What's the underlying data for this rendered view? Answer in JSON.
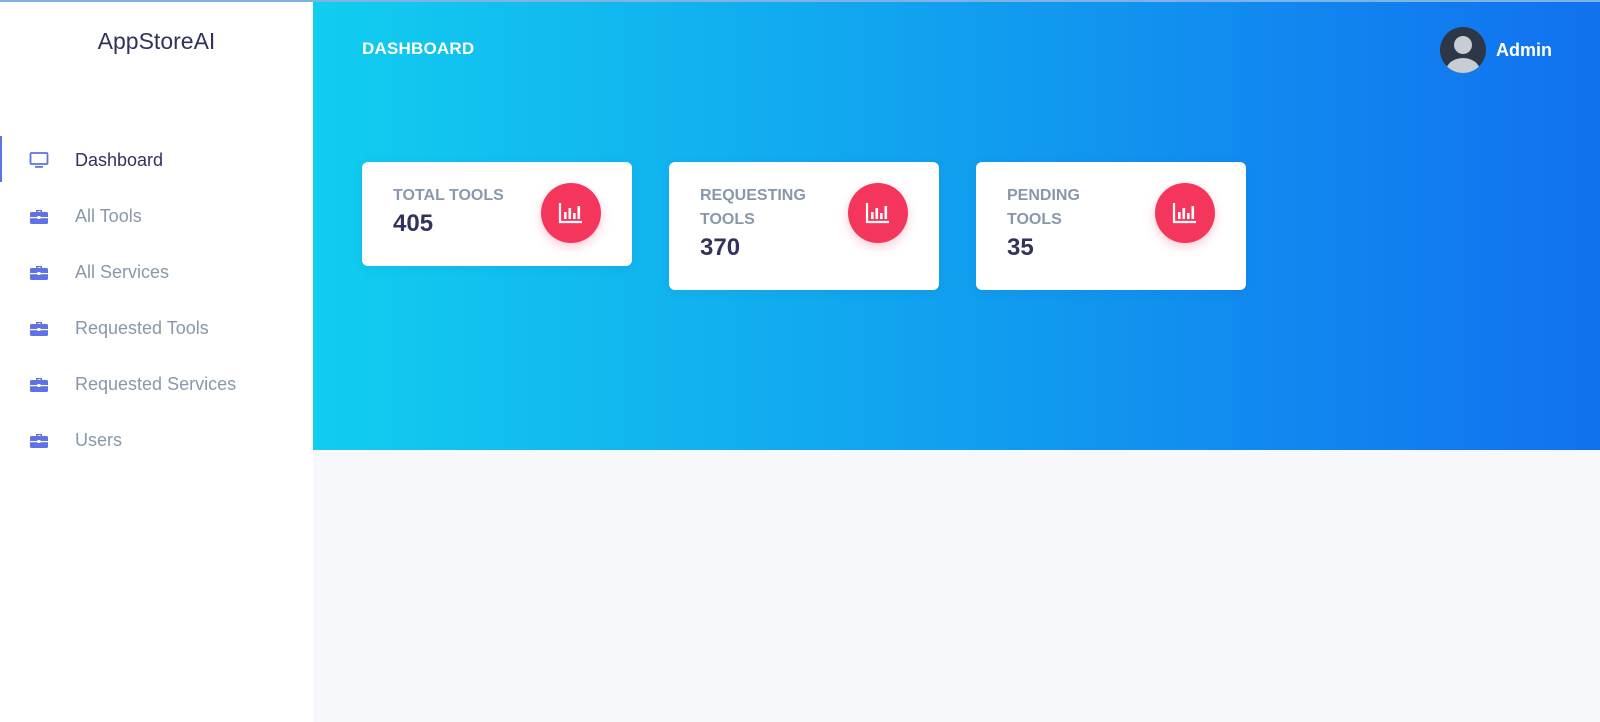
{
  "brand": "AppStoreAI",
  "page_title": "DASHBOARD",
  "user": {
    "name": "Admin",
    "avatar_icon": "user-avatar-icon"
  },
  "nav": [
    {
      "label": "Dashboard",
      "icon": "monitor-icon",
      "active": true
    },
    {
      "label": "All Tools",
      "icon": "briefcase-icon",
      "active": false
    },
    {
      "label": "All Services",
      "icon": "briefcase-icon",
      "active": false
    },
    {
      "label": "Requested Tools",
      "icon": "briefcase-icon",
      "active": false
    },
    {
      "label": "Requested Services",
      "icon": "briefcase-icon",
      "active": false
    },
    {
      "label": "Users",
      "icon": "briefcase-icon",
      "active": false
    }
  ],
  "stats": [
    {
      "title": "TOTAL TOOLS",
      "value": "405",
      "icon": "chart-bar-icon"
    },
    {
      "title": "REQUESTING TOOLS",
      "value": "370",
      "icon": "chart-bar-icon"
    },
    {
      "title": "PENDING TOOLS",
      "value": "35",
      "icon": "chart-bar-icon"
    }
  ],
  "colors": {
    "accent": "#5e72e4",
    "header_gradient_start": "#11cdef",
    "header_gradient_end": "#1171ef",
    "stat_icon_bg": "#f5365c"
  }
}
